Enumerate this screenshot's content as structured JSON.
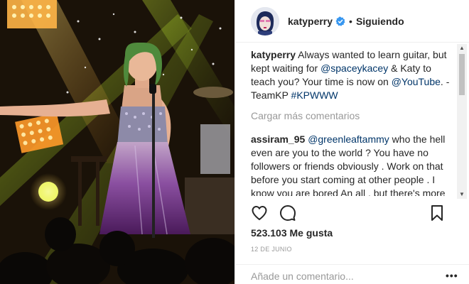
{
  "post": {
    "author": "katyperry",
    "follow_status": "Siguiendo",
    "separator": "•",
    "caption": {
      "user": "katyperry",
      "text_1": "Always wanted to learn guitar, but kept waiting for ",
      "mention_1": "@spaceykacey",
      "text_2": " & Katy to teach you? Your time is now on ",
      "mention_2": "@YouTube",
      "text_3": ". -TeamKP ",
      "hashtag": "#KPWWW"
    },
    "load_more": "Cargar más comentarios",
    "comment": {
      "user": "assiram_95",
      "mention": "@greenleaftammy",
      "text": " who the hell even are you to the world ? You have no followers or friends obviously . Work on that before you start coming at other people . I know you are bored An all , but there's more important things then yelling"
    },
    "likes": "523.103 Me gusta",
    "date": "12 DE JUNIO",
    "add_comment_placeholder": "Añade un comentario...",
    "more_options": "•••"
  },
  "icons": {
    "verified": "verified-badge-icon",
    "like": "heart-icon",
    "comment": "comment-icon",
    "save": "bookmark-icon"
  },
  "colors": {
    "verified_blue": "#3897f0",
    "link": "#003569",
    "muted": "#999999",
    "text": "#262626"
  }
}
